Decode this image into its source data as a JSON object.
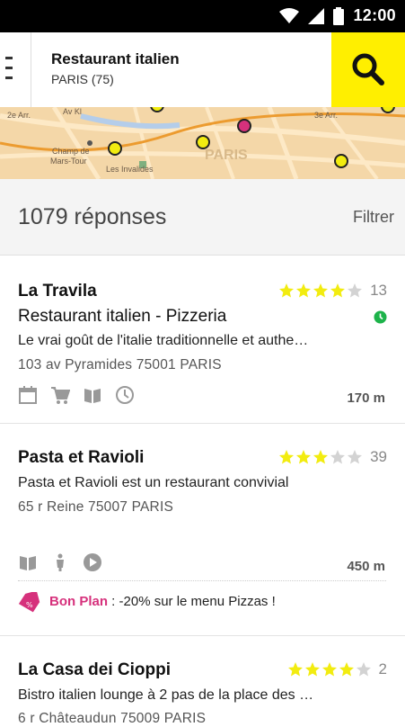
{
  "status_bar": {
    "time": "12:00",
    "icons": [
      "wifi-icon",
      "signal-icon",
      "battery-icon"
    ]
  },
  "search": {
    "query": "Restaurant italien",
    "location": "PARIS (75)",
    "accent": "#ffef00"
  },
  "map": {
    "labels": [
      "Champ de",
      "Mars-Tour",
      "Les Invalides",
      "PARIS",
      "Av Kl",
      "2e Arr.",
      "3e Arr."
    ],
    "pin_colors": [
      "#f2ec10",
      "#d6317c"
    ]
  },
  "results": {
    "count": "1079 réponses",
    "filter_label": "Filtrer"
  },
  "listings": [
    {
      "name": "La Travila",
      "category": "Restaurant italien - Pizzeria",
      "description": "Le vrai goût de l'italie traditionnelle et authe…",
      "address": "103 av Pyramides 75001 PARIS",
      "rating": 4,
      "reviews": "13",
      "distance": "170 m",
      "open_now": true,
      "icons": [
        "calendar-icon",
        "cart-icon",
        "menu-book-icon",
        "clock-icon"
      ]
    },
    {
      "name": "Pasta et Ravioli",
      "description": "Pasta et Ravioli est un restaurant convivial",
      "address": "65 r Reine 75007 PARIS",
      "rating": 3,
      "reviews": "39",
      "distance": "450 m",
      "icons": [
        "menu-book-icon",
        "scooter-icon",
        "play-icon"
      ],
      "promo": {
        "label": "Bon Plan",
        "text": " : -20% sur le menu Pizzas !"
      }
    },
    {
      "name": "La Casa dei Cioppi",
      "description": "Bistro italien lounge à 2 pas de la place des …",
      "address": "6 r Châteaudun 75009 PARIS",
      "rating": 4,
      "reviews": "2"
    }
  ],
  "colors": {
    "star": "#f2ec10",
    "star_empty": "#d3d3d3",
    "promo": "#d6317c",
    "open": "#1db34a"
  }
}
